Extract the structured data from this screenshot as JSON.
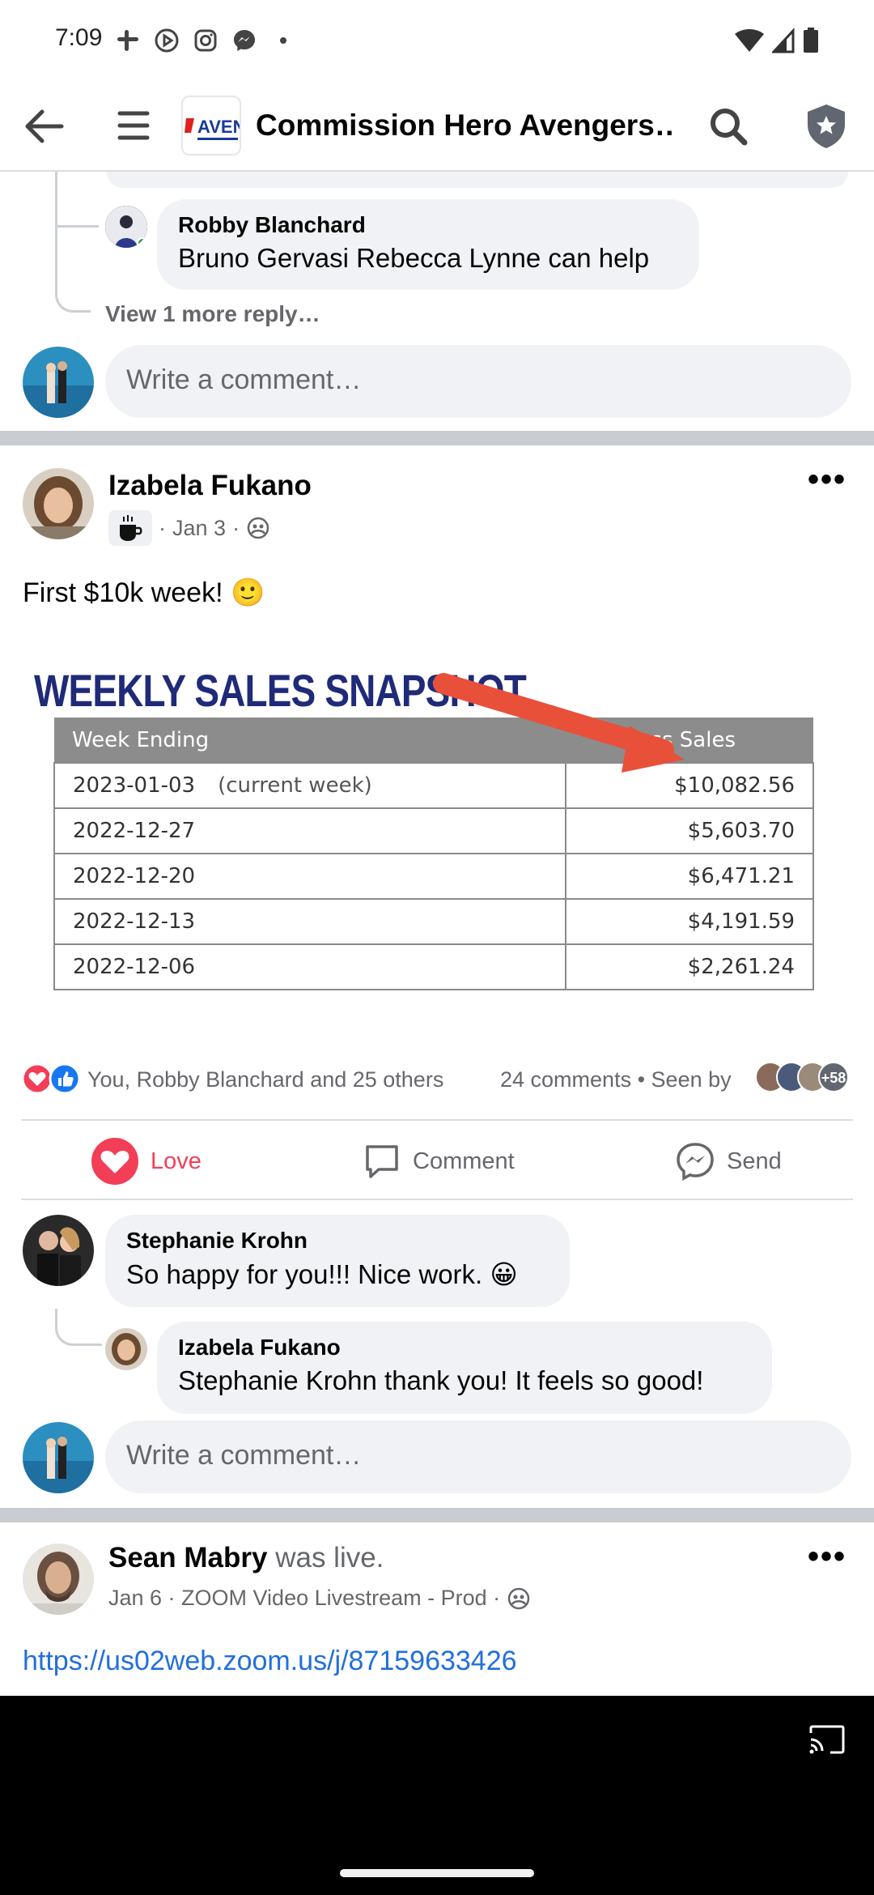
{
  "status_bar": {
    "time": "7:09"
  },
  "header": {
    "title": "Commission Hero Avengers…",
    "logo_text": "AVENG"
  },
  "prev_post": {
    "reply": {
      "author": "Robby Blanchard",
      "text": "Bruno Gervasi Rebecca Lynne can help"
    },
    "view_more": "View 1 more reply…",
    "comment_placeholder": "Write a comment…"
  },
  "post": {
    "author": "Izabela Fukano",
    "date": "Jan 3",
    "meta_sep": "·",
    "text": "First $10k week! 🙂",
    "image": {
      "title": "WEEKLY SALES SNAPSHOT",
      "col_week": "Week Ending",
      "col_sales": "Gross Sales",
      "rows": [
        {
          "week": "2023-01-03",
          "note": "(current week)",
          "sales": "$10,082.56"
        },
        {
          "week": "2022-12-27",
          "note": "",
          "sales": "$5,603.70"
        },
        {
          "week": "2022-12-20",
          "note": "",
          "sales": "$6,471.21"
        },
        {
          "week": "2022-12-13",
          "note": "",
          "sales": "$4,191.59"
        },
        {
          "week": "2022-12-06",
          "note": "",
          "sales": "$2,261.24"
        }
      ]
    },
    "reactions_text": "You, Robby Blanchard and 25 others",
    "comments_count": "24 comments",
    "seen_by": "Seen by",
    "seen_more": "+58",
    "actions": {
      "love": "Love",
      "comment": "Comment",
      "send": "Send"
    },
    "comments": [
      {
        "author": "Stephanie Krohn",
        "text": "So happy for you!!! Nice work. 😀"
      },
      {
        "author": "Izabela Fukano",
        "text": "Stephanie Krohn thank you! It feels so good!"
      }
    ],
    "comment_placeholder": "Write a comment…"
  },
  "next_post": {
    "author": "Sean Mabry",
    "status": "was live.",
    "meta": "Jan 6 · ZOOM Video Livestream - Prod ·",
    "link": "https://us02web.zoom.us/j/87159633426"
  },
  "colors": {
    "love": "#f33e58",
    "link": "#216fdb",
    "like": "#1877f2"
  }
}
